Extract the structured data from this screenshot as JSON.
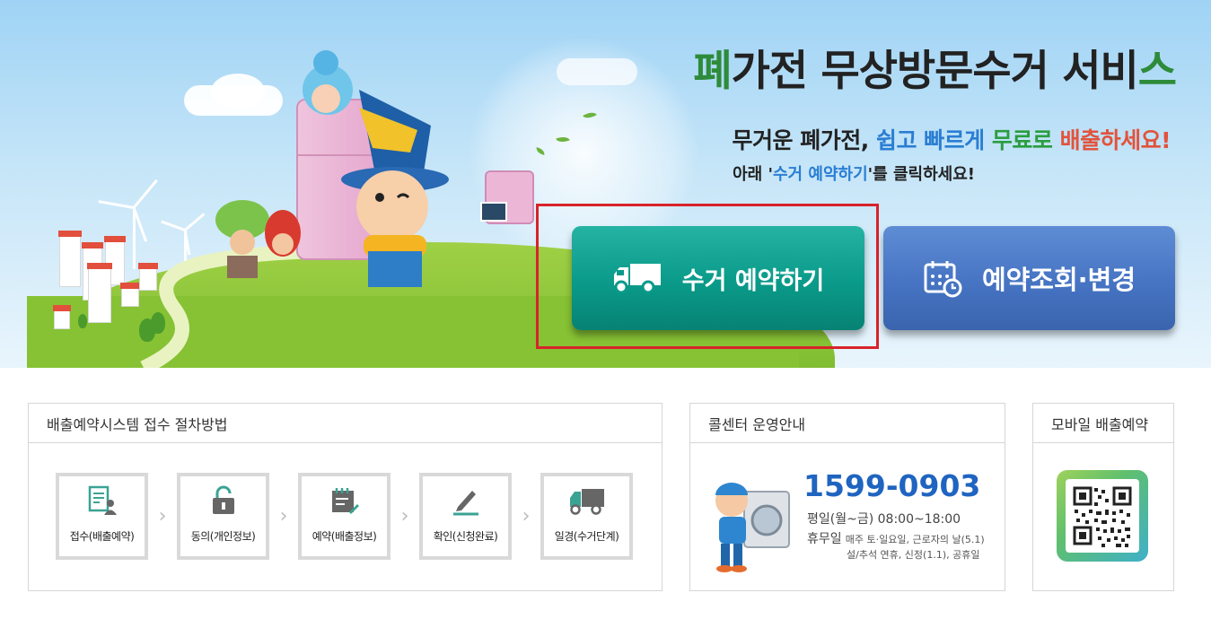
{
  "hero": {
    "title_part1": "폐",
    "title_part2": "가전 무상방문수거 서비",
    "title_part3": "스",
    "subtitle": {
      "p1": "무거운 폐가전, ",
      "p2": "쉽고 빠르게",
      "p3": " 무료로",
      "p4": " 배출하세요!"
    },
    "instruction": {
      "p1": "아래 '",
      "p2": "수거 예약하기",
      "p3": "'를 클릭하세요!"
    }
  },
  "buttons": {
    "pickup_label": "수거 예약하기",
    "check_label": "예약조회·변경"
  },
  "colors": {
    "pickup_button": "#0a9a89",
    "check_button": "#4674c3",
    "highlight_border": "#d8232a",
    "phone": "#1f64c0"
  },
  "procedure": {
    "heading": "배출예약시스템 접수 절차방법",
    "steps": [
      {
        "label": "접수(배출예약)",
        "icon": "document-user-icon"
      },
      {
        "label": "동의(개인정보)",
        "icon": "lock-icon"
      },
      {
        "label": "예약(배출정보)",
        "icon": "calendar-edit-icon"
      },
      {
        "label": "확인(신청완료)",
        "icon": "pen-icon"
      },
      {
        "label": "일경(수거단계)",
        "icon": "truck-icon"
      }
    ]
  },
  "callcenter": {
    "heading": "콜센터 운영안내",
    "phone": "1599-0903",
    "weekday": "평일(월~금)  08:00~18:00",
    "holiday_label": "휴무일",
    "holiday_detail": "매주 토·일요일, 근로자의 날(5.1)",
    "holiday_detail2": "설/추석 연휴, 신정(1.1), 공휴일"
  },
  "mobile": {
    "heading": "모바일 배출예약"
  }
}
